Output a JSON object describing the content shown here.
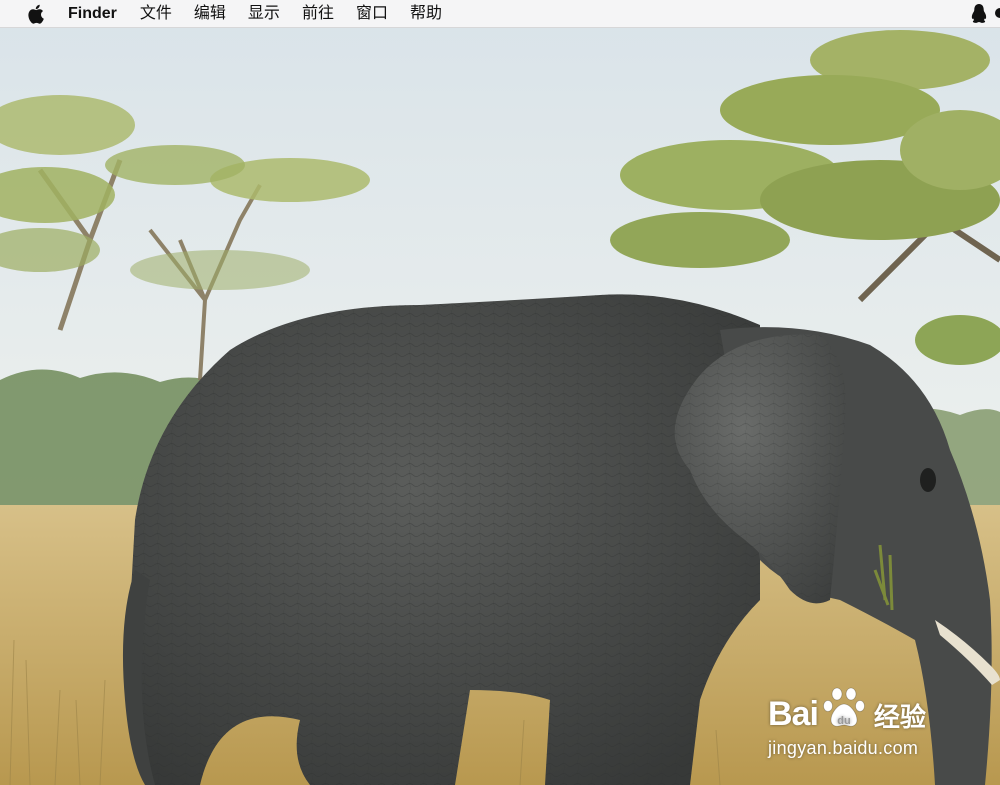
{
  "menubar": {
    "apple_icon": "apple-logo-icon",
    "app_name": "Finder",
    "items": [
      "文件",
      "编辑",
      "显示",
      "前往",
      "窗口",
      "帮助"
    ],
    "status_icons": [
      "qq-penguin-icon"
    ]
  },
  "watermark": {
    "logo_text_left": "Bai",
    "logo_text_right": "经验",
    "url": "jingyan.baidu.com"
  },
  "colors": {
    "menubar_bg": "#f6f6f6",
    "sky": "#dfe6ea",
    "grass": "#cdb16f",
    "elephant": "#4f5150",
    "foliage": "#8fa353"
  }
}
